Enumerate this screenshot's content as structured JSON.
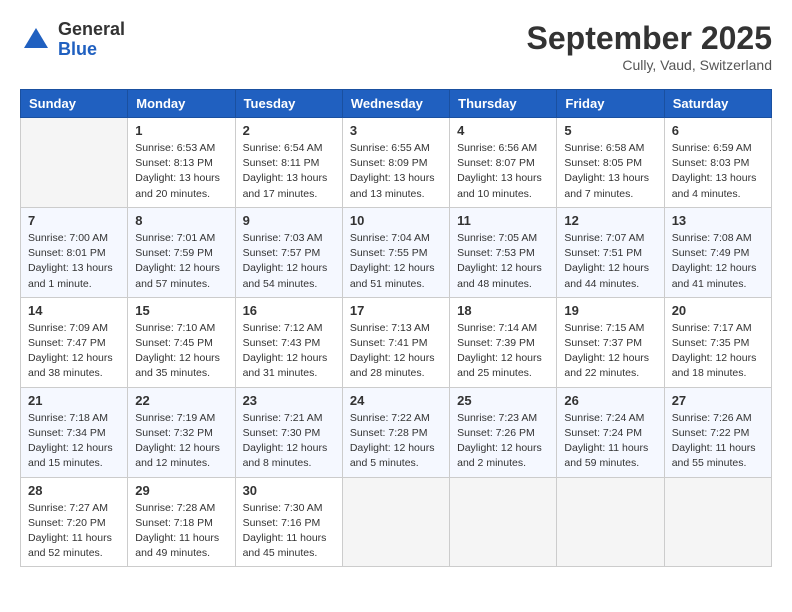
{
  "header": {
    "logo_general": "General",
    "logo_blue": "Blue",
    "title": "September 2025",
    "subtitle": "Cully, Vaud, Switzerland"
  },
  "days_of_week": [
    "Sunday",
    "Monday",
    "Tuesday",
    "Wednesday",
    "Thursday",
    "Friday",
    "Saturday"
  ],
  "weeks": [
    [
      {
        "day": "",
        "info": ""
      },
      {
        "day": "1",
        "info": "Sunrise: 6:53 AM\nSunset: 8:13 PM\nDaylight: 13 hours\nand 20 minutes."
      },
      {
        "day": "2",
        "info": "Sunrise: 6:54 AM\nSunset: 8:11 PM\nDaylight: 13 hours\nand 17 minutes."
      },
      {
        "day": "3",
        "info": "Sunrise: 6:55 AM\nSunset: 8:09 PM\nDaylight: 13 hours\nand 13 minutes."
      },
      {
        "day": "4",
        "info": "Sunrise: 6:56 AM\nSunset: 8:07 PM\nDaylight: 13 hours\nand 10 minutes."
      },
      {
        "day": "5",
        "info": "Sunrise: 6:58 AM\nSunset: 8:05 PM\nDaylight: 13 hours\nand 7 minutes."
      },
      {
        "day": "6",
        "info": "Sunrise: 6:59 AM\nSunset: 8:03 PM\nDaylight: 13 hours\nand 4 minutes."
      }
    ],
    [
      {
        "day": "7",
        "info": "Sunrise: 7:00 AM\nSunset: 8:01 PM\nDaylight: 13 hours\nand 1 minute."
      },
      {
        "day": "8",
        "info": "Sunrise: 7:01 AM\nSunset: 7:59 PM\nDaylight: 12 hours\nand 57 minutes."
      },
      {
        "day": "9",
        "info": "Sunrise: 7:03 AM\nSunset: 7:57 PM\nDaylight: 12 hours\nand 54 minutes."
      },
      {
        "day": "10",
        "info": "Sunrise: 7:04 AM\nSunset: 7:55 PM\nDaylight: 12 hours\nand 51 minutes."
      },
      {
        "day": "11",
        "info": "Sunrise: 7:05 AM\nSunset: 7:53 PM\nDaylight: 12 hours\nand 48 minutes."
      },
      {
        "day": "12",
        "info": "Sunrise: 7:07 AM\nSunset: 7:51 PM\nDaylight: 12 hours\nand 44 minutes."
      },
      {
        "day": "13",
        "info": "Sunrise: 7:08 AM\nSunset: 7:49 PM\nDaylight: 12 hours\nand 41 minutes."
      }
    ],
    [
      {
        "day": "14",
        "info": "Sunrise: 7:09 AM\nSunset: 7:47 PM\nDaylight: 12 hours\nand 38 minutes."
      },
      {
        "day": "15",
        "info": "Sunrise: 7:10 AM\nSunset: 7:45 PM\nDaylight: 12 hours\nand 35 minutes."
      },
      {
        "day": "16",
        "info": "Sunrise: 7:12 AM\nSunset: 7:43 PM\nDaylight: 12 hours\nand 31 minutes."
      },
      {
        "day": "17",
        "info": "Sunrise: 7:13 AM\nSunset: 7:41 PM\nDaylight: 12 hours\nand 28 minutes."
      },
      {
        "day": "18",
        "info": "Sunrise: 7:14 AM\nSunset: 7:39 PM\nDaylight: 12 hours\nand 25 minutes."
      },
      {
        "day": "19",
        "info": "Sunrise: 7:15 AM\nSunset: 7:37 PM\nDaylight: 12 hours\nand 22 minutes."
      },
      {
        "day": "20",
        "info": "Sunrise: 7:17 AM\nSunset: 7:35 PM\nDaylight: 12 hours\nand 18 minutes."
      }
    ],
    [
      {
        "day": "21",
        "info": "Sunrise: 7:18 AM\nSunset: 7:34 PM\nDaylight: 12 hours\nand 15 minutes."
      },
      {
        "day": "22",
        "info": "Sunrise: 7:19 AM\nSunset: 7:32 PM\nDaylight: 12 hours\nand 12 minutes."
      },
      {
        "day": "23",
        "info": "Sunrise: 7:21 AM\nSunset: 7:30 PM\nDaylight: 12 hours\nand 8 minutes."
      },
      {
        "day": "24",
        "info": "Sunrise: 7:22 AM\nSunset: 7:28 PM\nDaylight: 12 hours\nand 5 minutes."
      },
      {
        "day": "25",
        "info": "Sunrise: 7:23 AM\nSunset: 7:26 PM\nDaylight: 12 hours\nand 2 minutes."
      },
      {
        "day": "26",
        "info": "Sunrise: 7:24 AM\nSunset: 7:24 PM\nDaylight: 11 hours\nand 59 minutes."
      },
      {
        "day": "27",
        "info": "Sunrise: 7:26 AM\nSunset: 7:22 PM\nDaylight: 11 hours\nand 55 minutes."
      }
    ],
    [
      {
        "day": "28",
        "info": "Sunrise: 7:27 AM\nSunset: 7:20 PM\nDaylight: 11 hours\nand 52 minutes."
      },
      {
        "day": "29",
        "info": "Sunrise: 7:28 AM\nSunset: 7:18 PM\nDaylight: 11 hours\nand 49 minutes."
      },
      {
        "day": "30",
        "info": "Sunrise: 7:30 AM\nSunset: 7:16 PM\nDaylight: 11 hours\nand 45 minutes."
      },
      {
        "day": "",
        "info": ""
      },
      {
        "day": "",
        "info": ""
      },
      {
        "day": "",
        "info": ""
      },
      {
        "day": "",
        "info": ""
      }
    ]
  ]
}
